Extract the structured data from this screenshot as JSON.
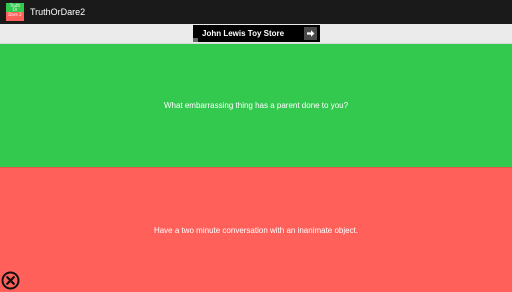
{
  "app": {
    "title": "TruthOrDare2",
    "icon_name": "truth-or-dare-app-icon",
    "icon_lines": [
      "Truth",
      "Or",
      "Dare 2"
    ]
  },
  "ad": {
    "text": "John Lewis Toy Store",
    "arrow_icon": "arrow-right-icon"
  },
  "truth": {
    "question": "What embarrassing thing has a parent done to you?",
    "color": "#33c94f"
  },
  "dare": {
    "question": "Have a two minute conversation with an inanimate object.",
    "color": "#ff605a"
  },
  "close": {
    "icon": "close-circle-icon"
  }
}
